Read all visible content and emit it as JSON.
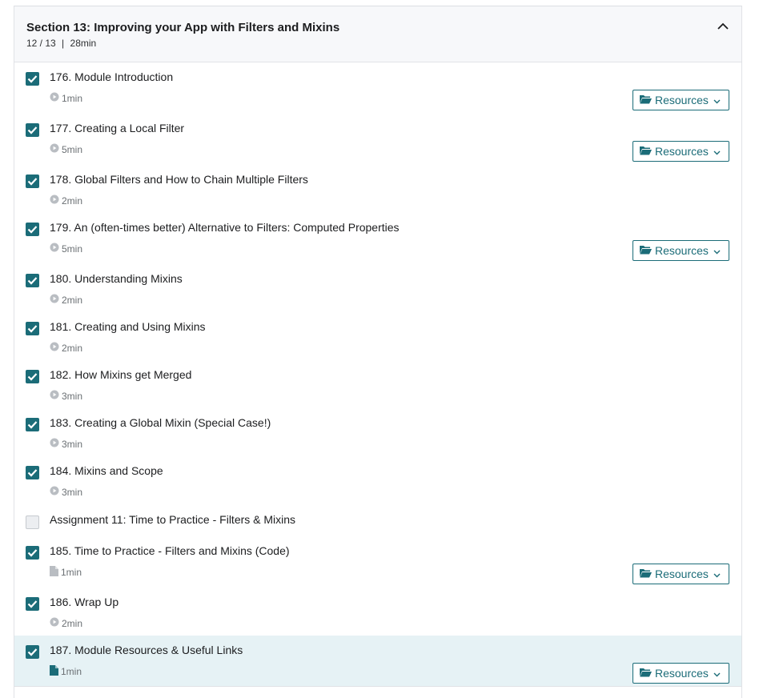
{
  "section": {
    "title": "Section 13: Improving your App with Filters and Mixins",
    "progress": "12 / 13",
    "separator": "|",
    "duration": "28min"
  },
  "resources_label": "Resources",
  "items": [
    {
      "title": "176. Module Introduction",
      "duration": "1min",
      "type": "video",
      "checked": true,
      "resources": true
    },
    {
      "title": "177. Creating a Local Filter",
      "duration": "5min",
      "type": "video",
      "checked": true,
      "resources": true
    },
    {
      "title": "178. Global Filters and How to Chain Multiple Filters",
      "duration": "2min",
      "type": "video",
      "checked": true,
      "resources": false
    },
    {
      "title": "179. An (often-times better) Alternative to Filters: Computed Properties",
      "duration": "5min",
      "type": "video",
      "checked": true,
      "resources": true
    },
    {
      "title": "180. Understanding Mixins",
      "duration": "2min",
      "type": "video",
      "checked": true,
      "resources": false
    },
    {
      "title": "181. Creating and Using Mixins",
      "duration": "2min",
      "type": "video",
      "checked": true,
      "resources": false
    },
    {
      "title": "182. How Mixins get Merged",
      "duration": "3min",
      "type": "video",
      "checked": true,
      "resources": false
    },
    {
      "title": "183. Creating a Global Mixin (Special Case!)",
      "duration": "3min",
      "type": "video",
      "checked": true,
      "resources": false
    },
    {
      "title": "184. Mixins and Scope",
      "duration": "3min",
      "type": "video",
      "checked": true,
      "resources": false
    },
    {
      "title": "Assignment 11: Time to Practice - Filters & Mixins",
      "duration": "",
      "type": "assignment",
      "checked": false,
      "resources": false
    },
    {
      "title": "185. Time to Practice - Filters and Mixins (Code)",
      "duration": "1min",
      "type": "file",
      "checked": true,
      "resources": true
    },
    {
      "title": "186. Wrap Up",
      "duration": "2min",
      "type": "video",
      "checked": true,
      "resources": false
    },
    {
      "title": "187. Module Resources & Useful Links",
      "duration": "1min",
      "type": "file",
      "checked": true,
      "resources": true,
      "active": true
    }
  ],
  "colors": {
    "accent": "#1b6c78",
    "active_row": "#e6f2f5",
    "header_bg": "#f7f8fa"
  }
}
